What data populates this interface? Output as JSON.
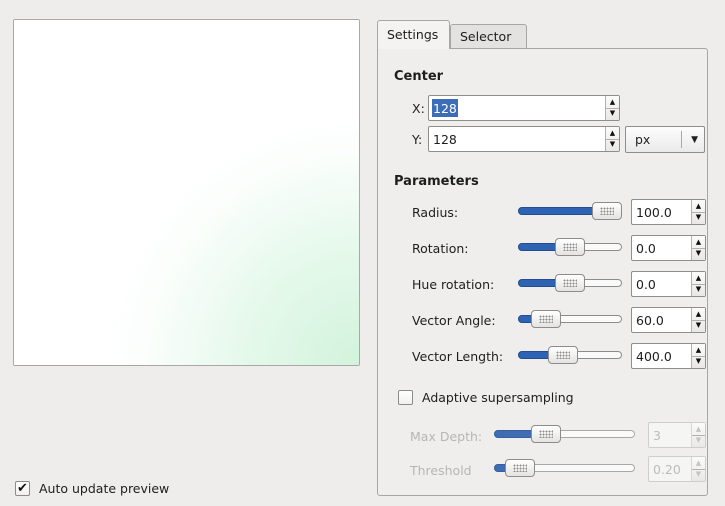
{
  "preview": {
    "auto_update_label": "Auto update preview",
    "auto_update_checked": true
  },
  "tabs": [
    {
      "label": "Settings",
      "active": true
    },
    {
      "label": "Selector",
      "active": false
    }
  ],
  "center": {
    "title": "Center",
    "x_label": "X:",
    "x_value": "128",
    "y_label": "Y:",
    "y_value": "128",
    "unit": "px"
  },
  "parameters": {
    "title": "Parameters",
    "rows": [
      {
        "label": "Radius:",
        "value": "100.0",
        "fraction": 1.0
      },
      {
        "label": "Rotation:",
        "value": "0.0",
        "fraction": 0.5
      },
      {
        "label": "Hue rotation:",
        "value": "0.0",
        "fraction": 0.5
      },
      {
        "label": "Vector Angle:",
        "value": "60.0",
        "fraction": 0.17
      },
      {
        "label": "Vector Length:",
        "value": "400.0",
        "fraction": 0.4
      }
    ]
  },
  "adaptive": {
    "label": "Adaptive supersampling",
    "checked": false,
    "max_depth_label": "Max Depth:",
    "max_depth_value": "3",
    "max_depth_fraction": 0.33,
    "threshold_label": "Threshold",
    "threshold_value": "0.20",
    "threshold_fraction": 0.1
  },
  "colors": {
    "accent": "#2e63b4",
    "selection": "#3b6db8",
    "preview_tint": "#d6f5df"
  }
}
